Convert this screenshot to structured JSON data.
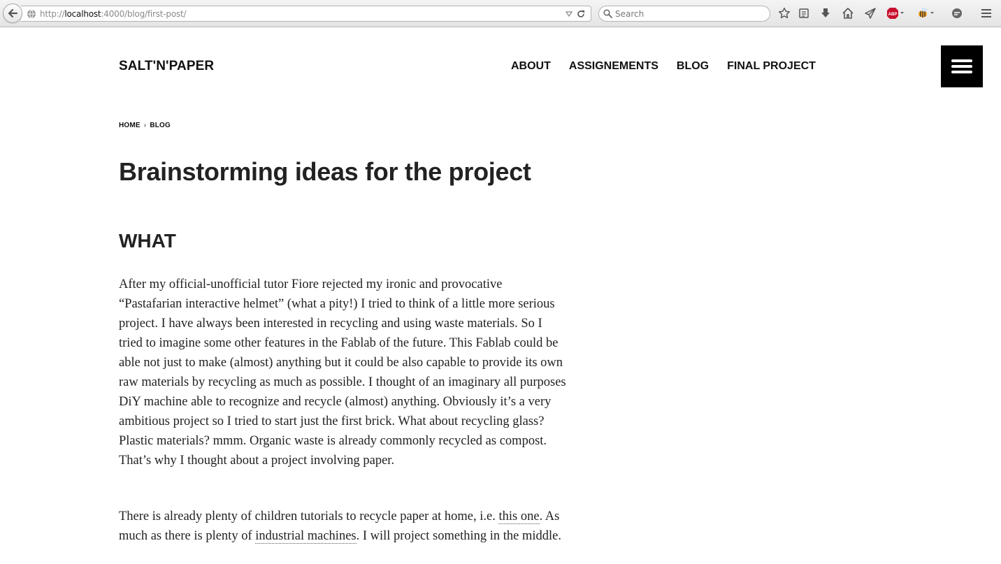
{
  "browser": {
    "url_prefix": "http://",
    "url_host": "localhost",
    "url_path": ":4000/blog/first-post/",
    "search_placeholder": "Search"
  },
  "site": {
    "title": "SALT'N'PAPER",
    "nav": [
      "ABOUT",
      "ASSIGNEMENTS",
      "BLOG",
      "FINAL PROJECT"
    ]
  },
  "breadcrumb": {
    "home": "HOME",
    "separator": "›",
    "current": "BLOG"
  },
  "post": {
    "title": "Brainstorming ideas for the project",
    "section_heading": "WHAT",
    "paragraph1": "After my official-unofficial tutor Fiore rejected my ironic and provocative “Pastafarian interactive helmet” (what a pity!) I tried to think of a little more serious project. I have always been interested in recycling and using waste materials. So I tried to imagine some other features in the Fablab of the future. This Fablab could be able not just to make (almost) anything but it could be also capable to provide its own raw materials by recycling as much as possible. I thought of an imaginary all purposes DiY machine able to recognize and recycle (almost) anything. Obviously it’s a very ambitious project so I tried to start just the first brick. What about recycling glass? Plastic materials? mmm. Organic waste is already commonly recycled as compost. That’s why I thought about a project involving paper.",
    "paragraph2_a": "There is already plenty of children tutorials to recycle paper at home, i.e. ",
    "paragraph2_link1": "this one",
    "paragraph2_b": ". As much as there is plenty of ",
    "paragraph2_link2": "industrial machines",
    "paragraph2_c": ". I will project something in the middle."
  },
  "icons": {
    "toolbar": [
      "back-icon",
      "globe-icon",
      "dropdown-icon",
      "reload-icon",
      "search-icon",
      "star-icon",
      "reader-icon",
      "download-icon",
      "home-icon",
      "send-icon",
      "adblock-icon",
      "bee-extension-icon",
      "chat-icon",
      "menu-icon"
    ]
  },
  "colors": {
    "menu_button_bg": "#000000",
    "adblock_red": "#c8102e"
  }
}
